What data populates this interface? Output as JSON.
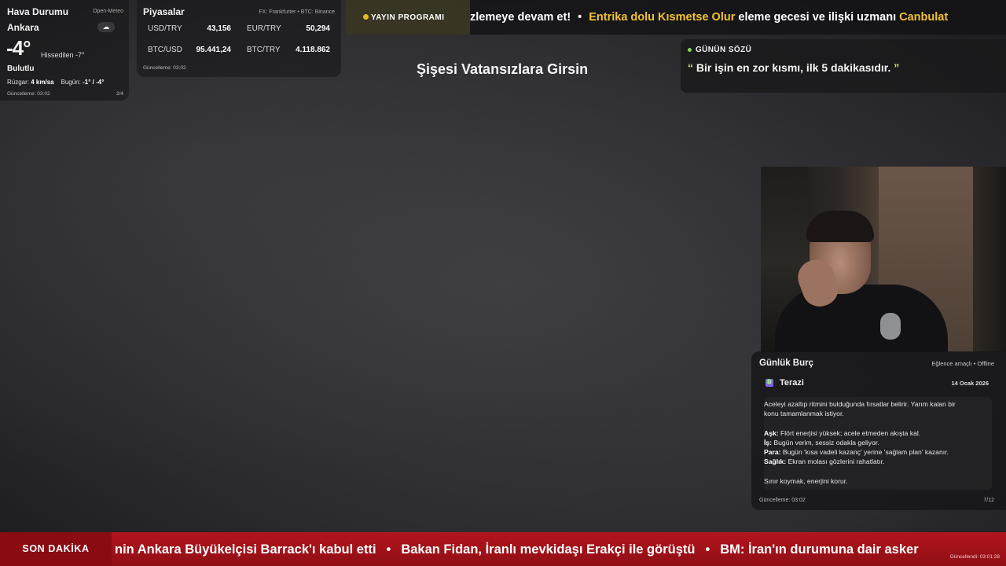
{
  "weather": {
    "title": "Hava Durumu",
    "source": "Open-Meteo",
    "city": "Ankara",
    "icon": "cloud-icon",
    "icon_glyph": "☁",
    "temperature": "-4°",
    "feels_like": "Hissedilen -7°",
    "condition": "Bulutlu",
    "wind_label": "Rüzgar:",
    "wind_value": "4 km/sa",
    "today_label": "Bugün:",
    "today_value": "-1° / -4°",
    "updated": "Güncelleme: 03:02",
    "page": "2/4"
  },
  "markets": {
    "title": "Piyasalar",
    "source": "FX: Frankfurter • BTC: Binance",
    "items": [
      {
        "name": "USD/TRY",
        "value": "43,156"
      },
      {
        "name": "EUR/TRY",
        "value": "50,294"
      },
      {
        "name": "BTC/USD",
        "value": "95.441,24"
      },
      {
        "name": "BTC/TRY",
        "value": "4.118.862"
      }
    ],
    "updated": "Güncelleme: 03:02"
  },
  "top_ticker": {
    "badge": "YAYIN PROGRAMI",
    "badge_dot_color": "#e8b923",
    "segment1": "zlemeye devam et!",
    "separator": "•",
    "segment2_highlight": "Entrika dolu Kısmetse Olur",
    "segment2_rest": " eleme gecesi ve ilişki uzmanı ",
    "segment3_highlight": "Canbulat"
  },
  "stream_title": "Şişesi Vatansızlara Girsin",
  "quote": {
    "label": "GÜNÜN SÖZÜ",
    "open_mark": "“",
    "text": " Bir işin en zor kısmı, ilk 5 dakikasıdır. ",
    "close_mark": "”",
    "accent_color": "#cde55a"
  },
  "horoscope": {
    "title": "Günlük Burç",
    "note": "Eğlence amaçlı • Offline",
    "sign_icon": "libra-icon",
    "sign_glyph": "♎",
    "sign": "Terazi",
    "date": "14 Ocak 2026",
    "summary_line1": "Aceleyi azaltıp ritmini bulduğunda fırsatlar belirir. Yarım kalan bir",
    "summary_line2": "konu tamamlanmak istiyor.",
    "love_label": "Aşk:",
    "love_text": " Flört enerjisi yüksek; acele etmeden akışta kal.",
    "work_label": "İş:",
    "work_text": " Bugün verim, sessiz odakla geliyor.",
    "money_label": "Para:",
    "money_text": " Bugün 'kısa vadeli kazanç' yerine 'sağlam plan' kazanır.",
    "health_label": "Sağlık:",
    "health_text": " Ekran molası gözlerini rahatlatır.",
    "advice": "Sınır koymak, enerjini korur.",
    "updated": "Güncelleme: 03:02",
    "page": "7/12"
  },
  "breaking": {
    "label": "SON DAKİKA",
    "items": [
      "nin Ankara Büyükelçisi Barrack'ı kabul etti",
      "Bakan Fidan, İranlı mevkidaşı Erakçi ile görüştü",
      "BM: İran'ın durumuna dair asker"
    ],
    "separator": "•",
    "updated": "Güncellendi: 03:01:28"
  }
}
